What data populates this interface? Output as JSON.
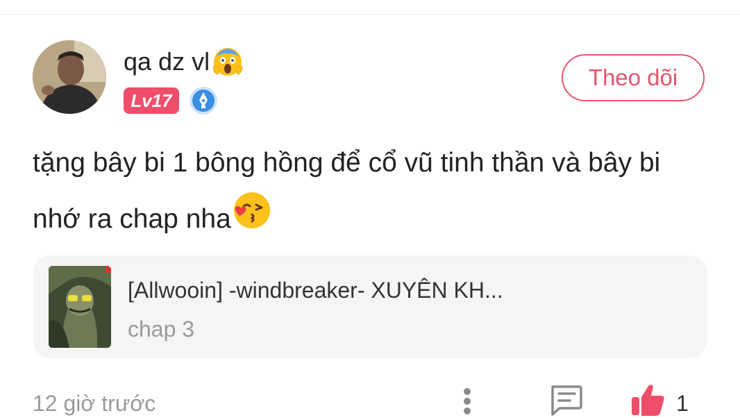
{
  "comment": {
    "user": {
      "name": "qa dz vl",
      "name_emoji": "screaming-face-emoji",
      "level": "Lv17",
      "medal_icon": "pen-medal-icon"
    },
    "follow_label": "Theo dõi",
    "text_line1": "tặng bây bi 1 bông hồng để cổ vũ tinh thần và bây bi",
    "text_line2": "nhớ ra chap nha",
    "text_emoji": "kissing-heart-emoji",
    "reference": {
      "title": "[Allwooin] -windbreaker- XUYÊN KH...",
      "subtitle": "chap 3"
    },
    "timestamp": "12 giờ trước",
    "likes": "1"
  },
  "colors": {
    "accent": "#e2566c",
    "badge": "#ef4e6a",
    "muted_text": "#9a9a9a",
    "card_bg": "#f5f5f5"
  }
}
